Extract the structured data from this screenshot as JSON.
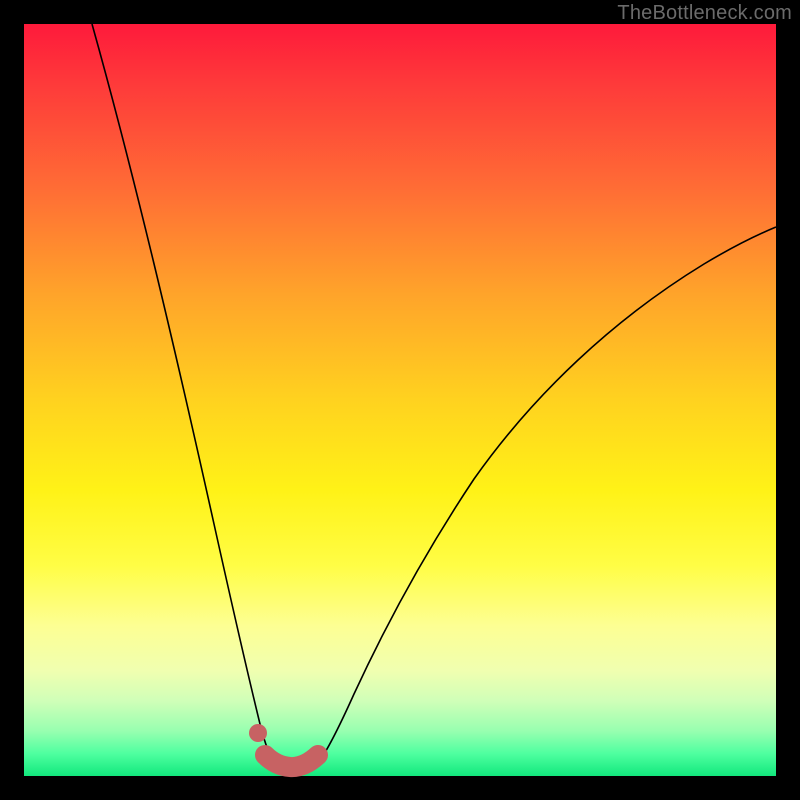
{
  "watermark": "TheBottleneck.com",
  "chart_data": {
    "type": "line",
    "title": "",
    "xlabel": "",
    "ylabel": "",
    "xlim": [
      0,
      100
    ],
    "ylim": [
      0,
      100
    ],
    "curve_left": {
      "x": [
        9,
        12,
        15,
        18,
        21,
        24,
        26,
        28,
        29.5,
        30.5,
        31.3,
        32
      ],
      "y": [
        100,
        78,
        60,
        45,
        32,
        20,
        12,
        7,
        4,
        2.5,
        1.8,
        1.4
      ]
    },
    "curve_right": {
      "x": [
        39,
        40,
        42,
        45,
        49,
        54,
        60,
        67,
        75,
        84,
        94,
        100
      ],
      "y": [
        1.4,
        2.0,
        4,
        8,
        14,
        22,
        31,
        40,
        49,
        57,
        65,
        70
      ]
    },
    "optimal_band": {
      "x": [
        32,
        33.5,
        35.5,
        37.5,
        39
      ],
      "y": [
        1.4,
        0.9,
        0.8,
        0.9,
        1.4
      ]
    },
    "marker": {
      "x": 31,
      "y": 4.5
    },
    "gradient_meaning": "top (red) = high bottleneck, bottom (green) = balanced",
    "grid": false,
    "legend": false
  }
}
